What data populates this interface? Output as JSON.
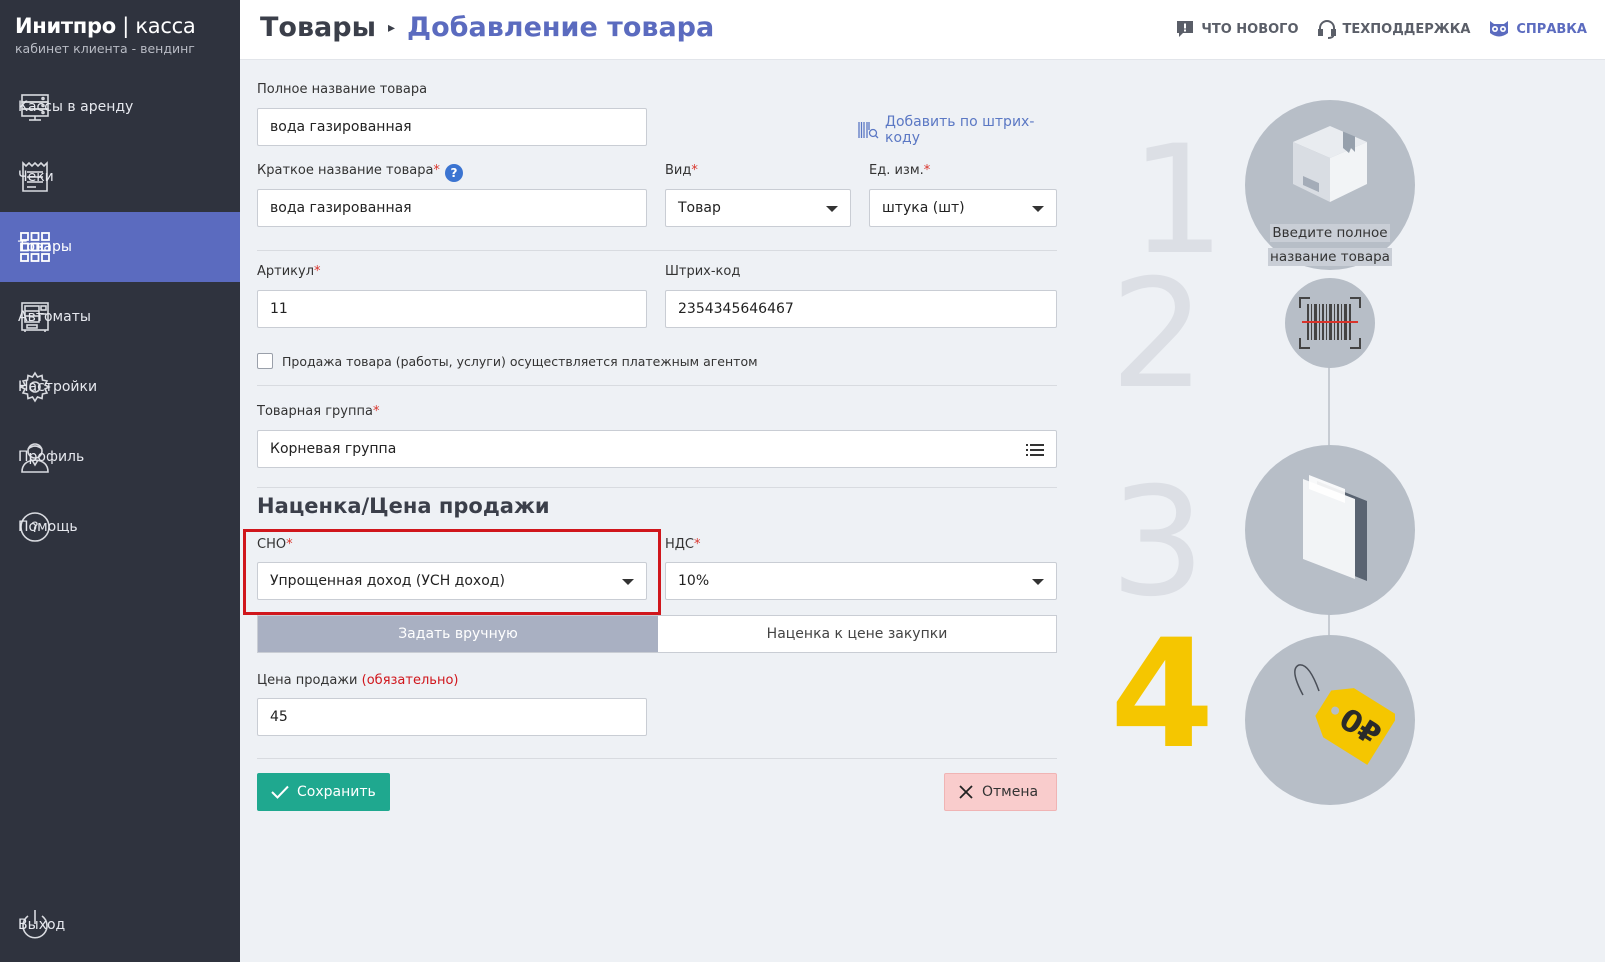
{
  "brand": {
    "name": "Инитпро",
    "separator": " | ",
    "product": "касса",
    "subtitle": "кабинет клиента - вендинг"
  },
  "sidebar": {
    "items": [
      {
        "label": "Кассы в аренду",
        "icon": "server-icon"
      },
      {
        "label": "Чеки",
        "icon": "receipt-icon"
      },
      {
        "label": "Товары",
        "icon": "grid-icon",
        "active": true
      },
      {
        "label": "Автоматы",
        "icon": "vending-machine-icon"
      },
      {
        "label": "Настройки",
        "icon": "gear-icon"
      },
      {
        "label": "Профиль",
        "icon": "user-icon"
      },
      {
        "label": "Помощь",
        "icon": "question-icon"
      }
    ],
    "logout": "Выход"
  },
  "header": {
    "crumb_root": "Товары",
    "crumb_current": "Добавление товара",
    "links": {
      "news": "ЧТО НОВОГО",
      "support": "ТЕХПОДДЕРЖКА",
      "help": "СПРАВКА"
    }
  },
  "form": {
    "full_name_label": "Полное название товара",
    "full_name_value": "вода газированная",
    "barcode_link": "Добавить по штрих-коду",
    "short_name_label": "Краткое название товара",
    "short_name_value": "вода газированная",
    "type_label": "Вид",
    "type_value": "Товар",
    "unit_label": "Ед. изм.",
    "unit_value": "штука (шт)",
    "article_label": "Артикул",
    "article_value": "11",
    "barcode_label": "Штрих-код",
    "barcode_value": "2354345646467",
    "agent_checkbox": "Продажа товара (работы, услуги) осуществляется платежным агентом",
    "group_label": "Товарная группа",
    "group_value": "Корневая группа",
    "price_section": "Наценка/Цена продажи",
    "sno_label": "СНО",
    "sno_value": "Упрощенная доход (УСН доход)",
    "vat_label": "НДС",
    "vat_value": "10%",
    "mode_manual": "Задать вручную",
    "mode_markup": "Наценка к цене закупки",
    "price_label": "Цена продажи",
    "price_required": "(обязательно)",
    "price_value": "45",
    "save": "Сохранить",
    "cancel": "Отмена",
    "required_mark": "*"
  },
  "steps": {
    "numbers": [
      "1",
      "2",
      "3",
      "4"
    ],
    "step1_line1": "Введите полное",
    "step1_line2": "название товара",
    "price_tag": "0₽",
    "colors": {
      "active": "#f5c600",
      "inactive": "#dcdfe5",
      "circle": "#b7bec7"
    }
  },
  "colors": {
    "sidebar": "#2f333e",
    "active_nav": "#5b6bbf",
    "accent": "#5b6bbf",
    "save": "#1fa88f",
    "cancel": "#f9cccc",
    "highlight": "#d0161c"
  }
}
